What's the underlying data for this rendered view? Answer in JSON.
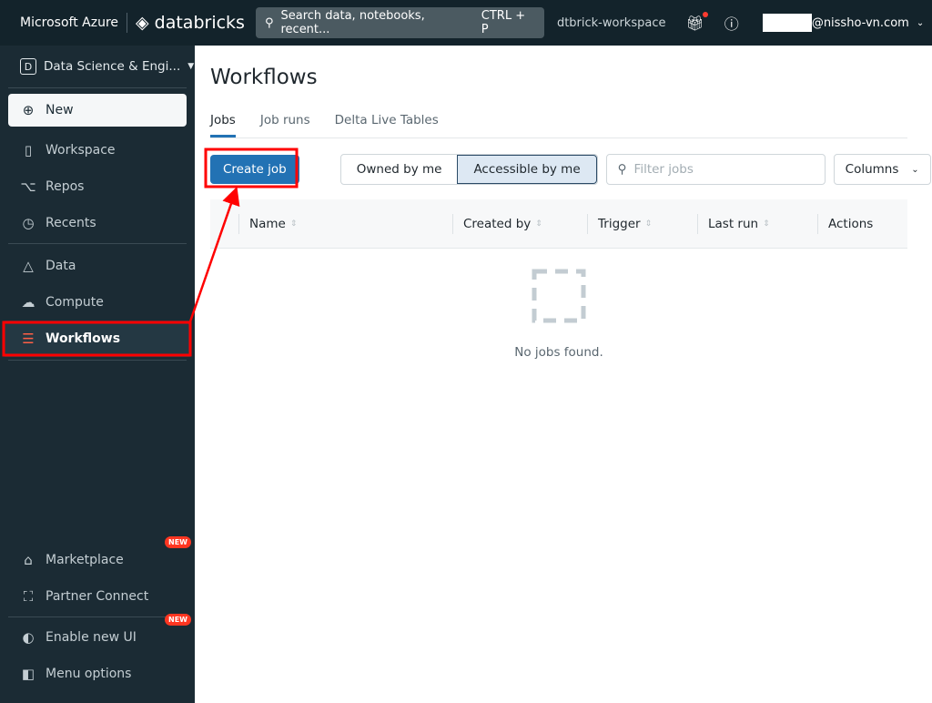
{
  "topbar": {
    "brand": "Microsoft Azure",
    "logo": "databricks",
    "search_placeholder": "Search data, notebooks, recent...",
    "shortcut": "CTRL + P",
    "workspace": "dtbrick-workspace",
    "user": "@nissho-vn.com"
  },
  "sidebar": {
    "persona": "Data Science & Engi...",
    "persona_letter": "D",
    "new_label": "New",
    "items": [
      {
        "label": "Workspace"
      },
      {
        "label": "Repos"
      },
      {
        "label": "Recents"
      },
      {
        "label": "Data"
      },
      {
        "label": "Compute"
      },
      {
        "label": "Workflows"
      }
    ],
    "bottom": [
      {
        "label": "Marketplace",
        "badge": "NEW"
      },
      {
        "label": "Partner Connect"
      },
      {
        "label": "Enable new UI",
        "badge": "NEW"
      },
      {
        "label": "Menu options"
      }
    ]
  },
  "main": {
    "title": "Workflows",
    "tabs": [
      "Jobs",
      "Job runs",
      "Delta Live Tables"
    ],
    "create_label": "Create job",
    "owned": "Owned by me",
    "accessible": "Accessible by me",
    "filter_placeholder": "Filter jobs",
    "columns": "Columns",
    "headers": [
      "Name",
      "Created by",
      "Trigger",
      "Last run",
      "Actions"
    ],
    "empty": "No jobs found."
  }
}
